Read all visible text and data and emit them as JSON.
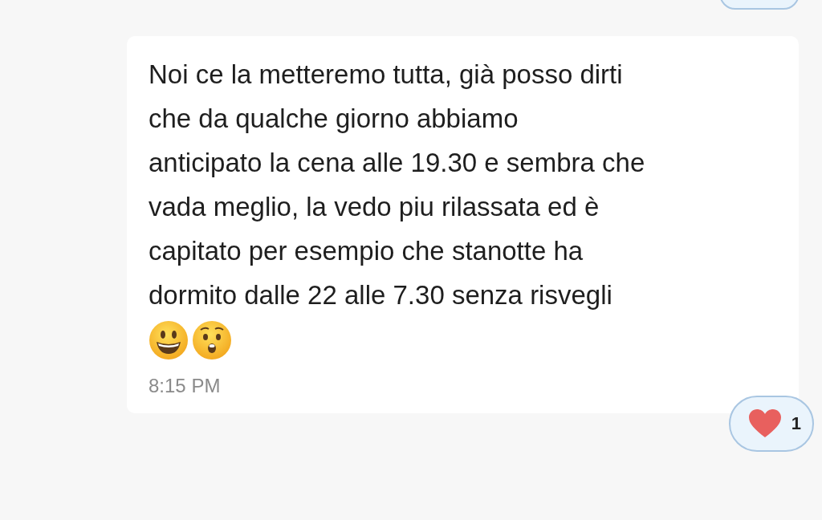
{
  "message": {
    "lines": [
      "Noi ce la metteremo tutta, già posso dirti",
      "che da qualche giorno abbiamo",
      "anticipato la cena alle 19.30 e sembra che",
      "vada meglio, la vedo piu rilassata ed è",
      "capitato per esempio che stanotte ha",
      "dormito dalle 22 alle 7.30 senza risvegli"
    ],
    "time": "8:15 PM",
    "reaction": {
      "count": "1"
    }
  }
}
